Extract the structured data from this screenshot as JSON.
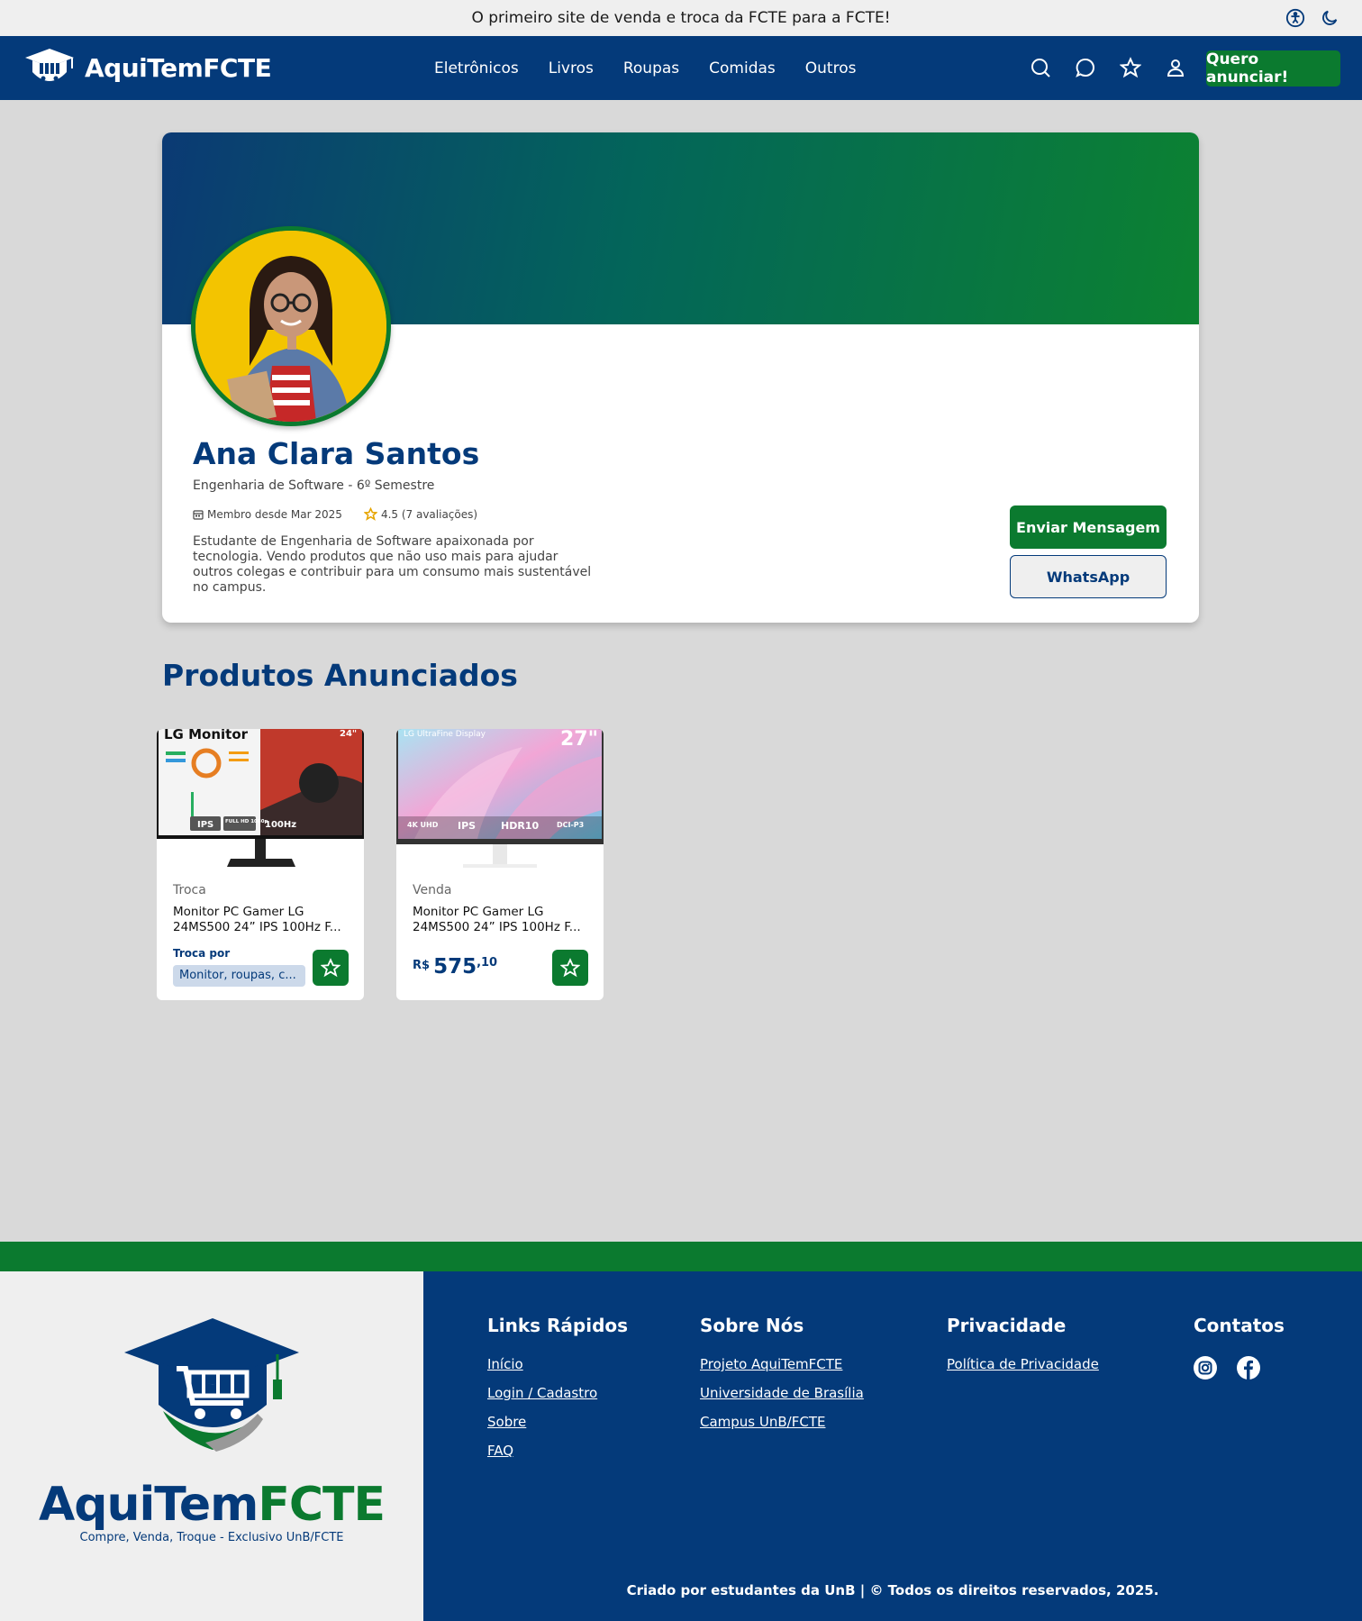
{
  "announcement": "O primeiro site de venda e troca da FCTE para a FCTE!",
  "header": {
    "brand": "AquiTemFCTE",
    "nav": [
      {
        "label": "Eletrônicos"
      },
      {
        "label": "Livros"
      },
      {
        "label": "Roupas"
      },
      {
        "label": "Comidas"
      },
      {
        "label": "Outros"
      }
    ],
    "icons": [
      "search-icon",
      "chat-icon",
      "star-icon",
      "user-icon"
    ],
    "cta": "Quero anunciar!"
  },
  "profile": {
    "name": "Ana Clara Santos",
    "course": "Engenharia de Software - 6º Semestre",
    "member_since": "Membro desde Mar 2025",
    "rating": "4.5 (7 avaliações)",
    "bio": "Estudante de Engenharia de Software apaixonada por tecnologia. Vendo  produtos que não uso mais para ajudar outros colegas e contribuir para  um consumo mais sustentável no campus.",
    "message_button": "Enviar Mensagem",
    "whatsapp_button": "WhatsApp"
  },
  "products_section": {
    "title": "Produtos Anunciados",
    "items": [
      {
        "type": "Troca",
        "title": "Monitor PC Gamer LG 24MS500 24” IPS 100Hz F...",
        "trade_label": "Troca por",
        "trade_value": "Monitor, roupas, c...",
        "image_text": {
          "brand": "LG Monitor",
          "size": "24\"",
          "badges": [
            "IPS",
            "FULL HD 1080p",
            "100Hz"
          ]
        }
      },
      {
        "type": "Venda",
        "title": "Monitor PC Gamer LG 24MS500 24” IPS 100Hz F...",
        "price_currency": "R$",
        "price_int": "575",
        "price_dec": ",10",
        "image_text": {
          "brand": "LG UltraFine Display",
          "size": "27\"",
          "badges": [
            "4K UHD",
            "IPS",
            "HDR10",
            "DCI-P3"
          ]
        }
      }
    ]
  },
  "footer": {
    "brand_part1": "AquiTem",
    "brand_part2": "FCTE",
    "tagline": "Compre, Venda, Troque - Exclusivo UnB/FCTE",
    "columns": [
      {
        "title": "Links Rápidos",
        "links": [
          "Início",
          "Login / Cadastro",
          "Sobre",
          "FAQ"
        ]
      },
      {
        "title": "Sobre Nós",
        "links": [
          "Projeto AquiTemFCTE",
          "Universidade de Brasília",
          "Campus UnB/FCTE"
        ]
      },
      {
        "title": "Privacidade",
        "links": [
          "Política de Privacidade"
        ]
      },
      {
        "title": "Contatos",
        "icons": [
          "instagram-icon",
          "facebook-icon"
        ]
      }
    ],
    "copyright": "Criado por estudantes da UnB | © Todos os direitos reservados, 2025."
  },
  "colors": {
    "brand_blue": "#043a7a",
    "brand_green": "#0b7a2f",
    "page_bg": "#d9d9d9"
  }
}
